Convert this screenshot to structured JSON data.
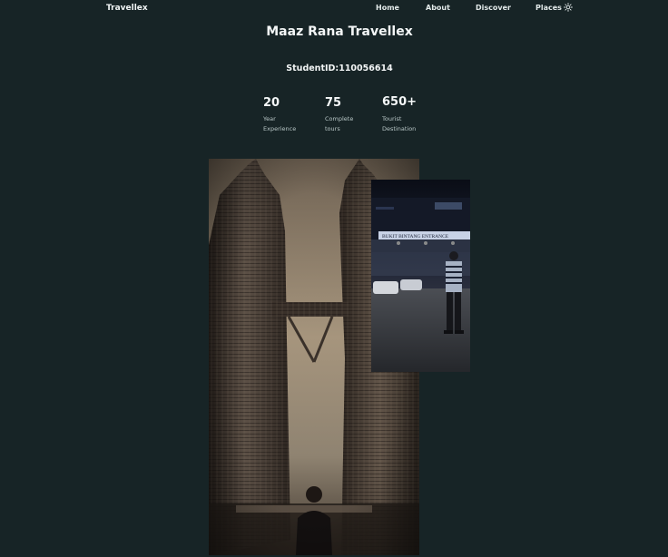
{
  "header": {
    "logo": "Travellex",
    "nav": {
      "home": "Home",
      "about": "About",
      "discover": "Discover",
      "places": "Places"
    },
    "theme_icon": "sun-icon"
  },
  "hero": {
    "title": "Maaz Rana Travellex",
    "student_id": "StudentID:110056614"
  },
  "stats": [
    {
      "value": "20",
      "label_line1": "Year",
      "label_line2": "Experience"
    },
    {
      "value": "75",
      "label_line1": "Complete",
      "label_line2": "tours"
    },
    {
      "value": "650+",
      "label_line1": "Tourist",
      "label_line2": "Destination"
    }
  ],
  "images": {
    "main": "petronas-towers-photo",
    "secondary": "night-street-photo",
    "secondary_sign": "BUKIT BINTANG ENTRANCE"
  },
  "colors": {
    "background": "#172426",
    "text": "#f3f6f6",
    "muted": "#b9c7c7"
  }
}
